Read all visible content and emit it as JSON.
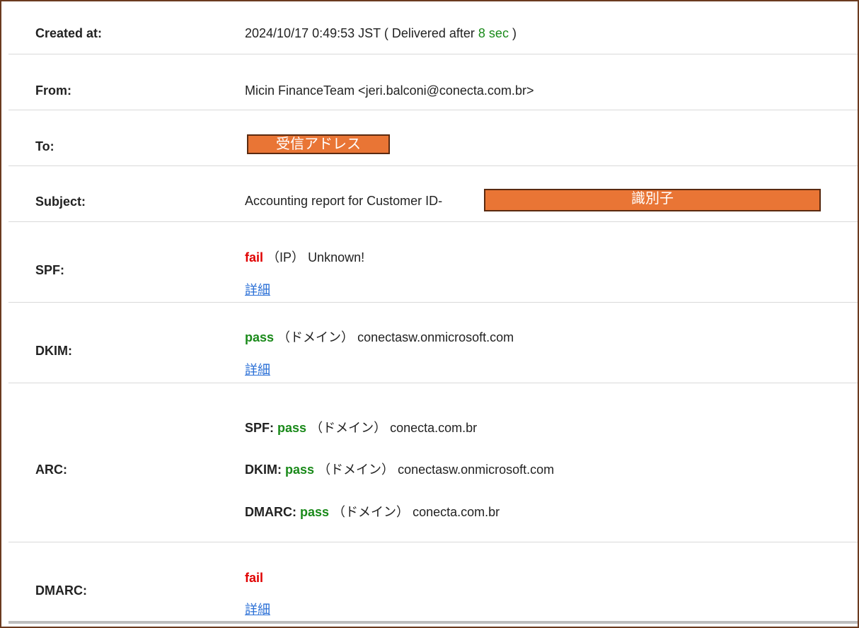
{
  "rows": {
    "created": {
      "label": "Created at:",
      "datetime": "2024/10/17 0:49:53 JST",
      "delivered_prefix": "( Delivered after",
      "delivered_value": "8 sec",
      "delivered_suffix": ")"
    },
    "from": {
      "label": "From:",
      "value": "Micin FinanceTeam <jeri.balconi@conecta.com.br>"
    },
    "to": {
      "label": "To:",
      "redaction": "受信アドレス"
    },
    "subject": {
      "label": "Subject:",
      "value": "Accounting report for Customer ID-",
      "redaction": "識別子"
    },
    "spf": {
      "label": "SPF:",
      "status": "fail",
      "kind": "（IP）",
      "detail": "Unknown!",
      "link": "詳細"
    },
    "dkim": {
      "label": "DKIM:",
      "status": "pass",
      "kind": "（ドメイン）",
      "detail": "conectasw.onmicrosoft.com",
      "link": "詳細"
    },
    "arc": {
      "label": "ARC:",
      "items": [
        {
          "name": "SPF:",
          "status": "pass",
          "kind": "（ドメイン）",
          "detail": "conecta.com.br"
        },
        {
          "name": "DKIM:",
          "status": "pass",
          "kind": "（ドメイン）",
          "detail": "conectasw.onmicrosoft.com"
        },
        {
          "name": "DMARC:",
          "status": "pass",
          "kind": "（ドメイン）",
          "detail": "conecta.com.br"
        }
      ]
    },
    "dmarc": {
      "label": "DMARC:",
      "status": "fail",
      "link": "詳細"
    }
  },
  "colors": {
    "pass": "#1a8a1a",
    "fail": "#e00000",
    "link": "#2a6fd6",
    "redaction": "#e97535",
    "frame": "#6b3a1f"
  }
}
